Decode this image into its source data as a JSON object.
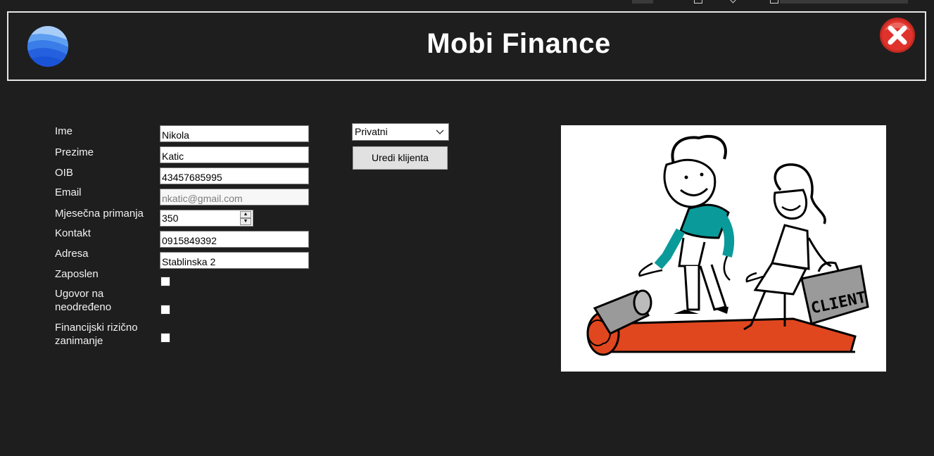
{
  "window": {
    "title": "Mobi Finance"
  },
  "icons": {
    "logo": "blue-wave-globe-icon",
    "close": "red-x-close-icon",
    "dropdown": "chevron-down-icon"
  },
  "colors": {
    "background": "#1e1e1e",
    "close_red": "#e0322c",
    "logo_blue": "#2d6fe0",
    "text": "#f2f2f2"
  },
  "form": {
    "labels": {
      "ime": "Ime",
      "prezime": "Prezime",
      "oib": "OIB",
      "email": "Email",
      "primanja": "Mjesečna primanja",
      "kontakt": "Kontakt",
      "adresa": "Adresa",
      "zaposlen": "Zaposlen",
      "ugovor": "Ugovor na neodređeno",
      "rizicno": "Financijski rizično zanimanje"
    },
    "values": {
      "ime": "Nikola",
      "prezime": "Katic",
      "oib": "43457685995",
      "email": "nkatic@gmail.com",
      "primanja": "350",
      "kontakt": "0915849392",
      "adresa": "Stablinska 2"
    },
    "checkboxes": {
      "zaposlen": false,
      "ugovor": false,
      "rizicno": false
    }
  },
  "client_type": {
    "selected": "Privatni"
  },
  "actions": {
    "edit_button": "Uredi klijenta"
  },
  "illustration": {
    "sign_text": "CLIENT"
  }
}
